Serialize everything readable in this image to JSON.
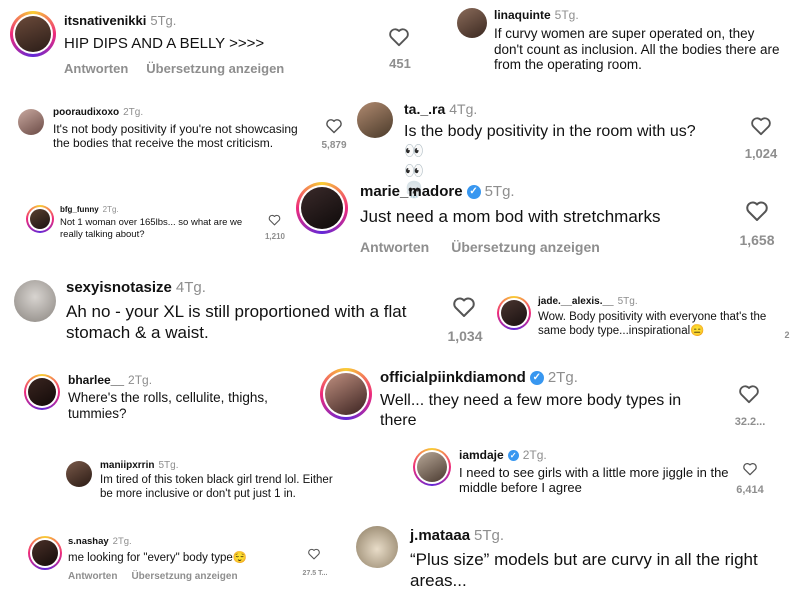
{
  "labels": {
    "reply": "Antworten",
    "translate": "Übersetzung anzeigen"
  },
  "comments": [
    {
      "user": "itsnativenikki",
      "age": "5Tg.",
      "text": "HIP DIPS AND A BELLY >>>>",
      "likes": "451"
    },
    {
      "user": "linaquinte",
      "age": "5Tg.",
      "text": "If curvy women are super operated on, they don't count as inclusion. All the bodies there are from the operating room."
    },
    {
      "user": "pooraudixoxo",
      "age": "2Tg.",
      "text": "It's not body positivity if you're not showcasing the bodies that receive the most criticism.",
      "likes": "5,879"
    },
    {
      "user": "ta._.ra",
      "age": "4Tg.",
      "text": "Is the body positivity in the room with us?",
      "emoji": "👀👀 💀",
      "likes": "1,024"
    },
    {
      "user": "bfg_funny",
      "age": "2Tg.",
      "text": "Not 1 woman over 165lbs... so what are we really talking about?",
      "likes": "1,210"
    },
    {
      "user": "marie_madore",
      "age": "5Tg.",
      "text": "Just need a mom bod with stretchmarks",
      "likes": "1,658",
      "verified": true
    },
    {
      "user": "sexyisnotasize",
      "age": "4Tg.",
      "text": "Ah no - your XL is still proportioned with a flat stomach & a waist.",
      "likes": "1,034"
    },
    {
      "user": "jade.__alexis.__",
      "age": "5Tg.",
      "text": "Wow. Body positivity with everyone that's the same body type...inspirational😑",
      "likes": "2"
    },
    {
      "user": "bharlee__",
      "age": "2Tg.",
      "text": "Where's the rolls, cellulite, thighs, tummies?"
    },
    {
      "user": "officialpiinkdiamond",
      "age": "2Tg.",
      "text": "Well... they need a few more body types in there",
      "likes": "32.2...",
      "verified": true
    },
    {
      "user": "maniipxrrin",
      "age": "5Tg.",
      "text": "Im tired of this token black girl trend lol. Either be more inclusive or don't put just 1 in."
    },
    {
      "user": "iamdaje",
      "age": "2Tg.",
      "text": "I need to see girls with a little more jiggle in the middle before I agree",
      "likes": "6,414",
      "verified": true
    },
    {
      "user": "s.nashay",
      "age": "2Tg.",
      "text": "me looking for \"every\" body type😌",
      "likes": "27.5 T..."
    },
    {
      "user": "j.mataaa",
      "age": "5Tg.",
      "text": "“Plus size” models but are curvy in all the right areas..."
    }
  ]
}
